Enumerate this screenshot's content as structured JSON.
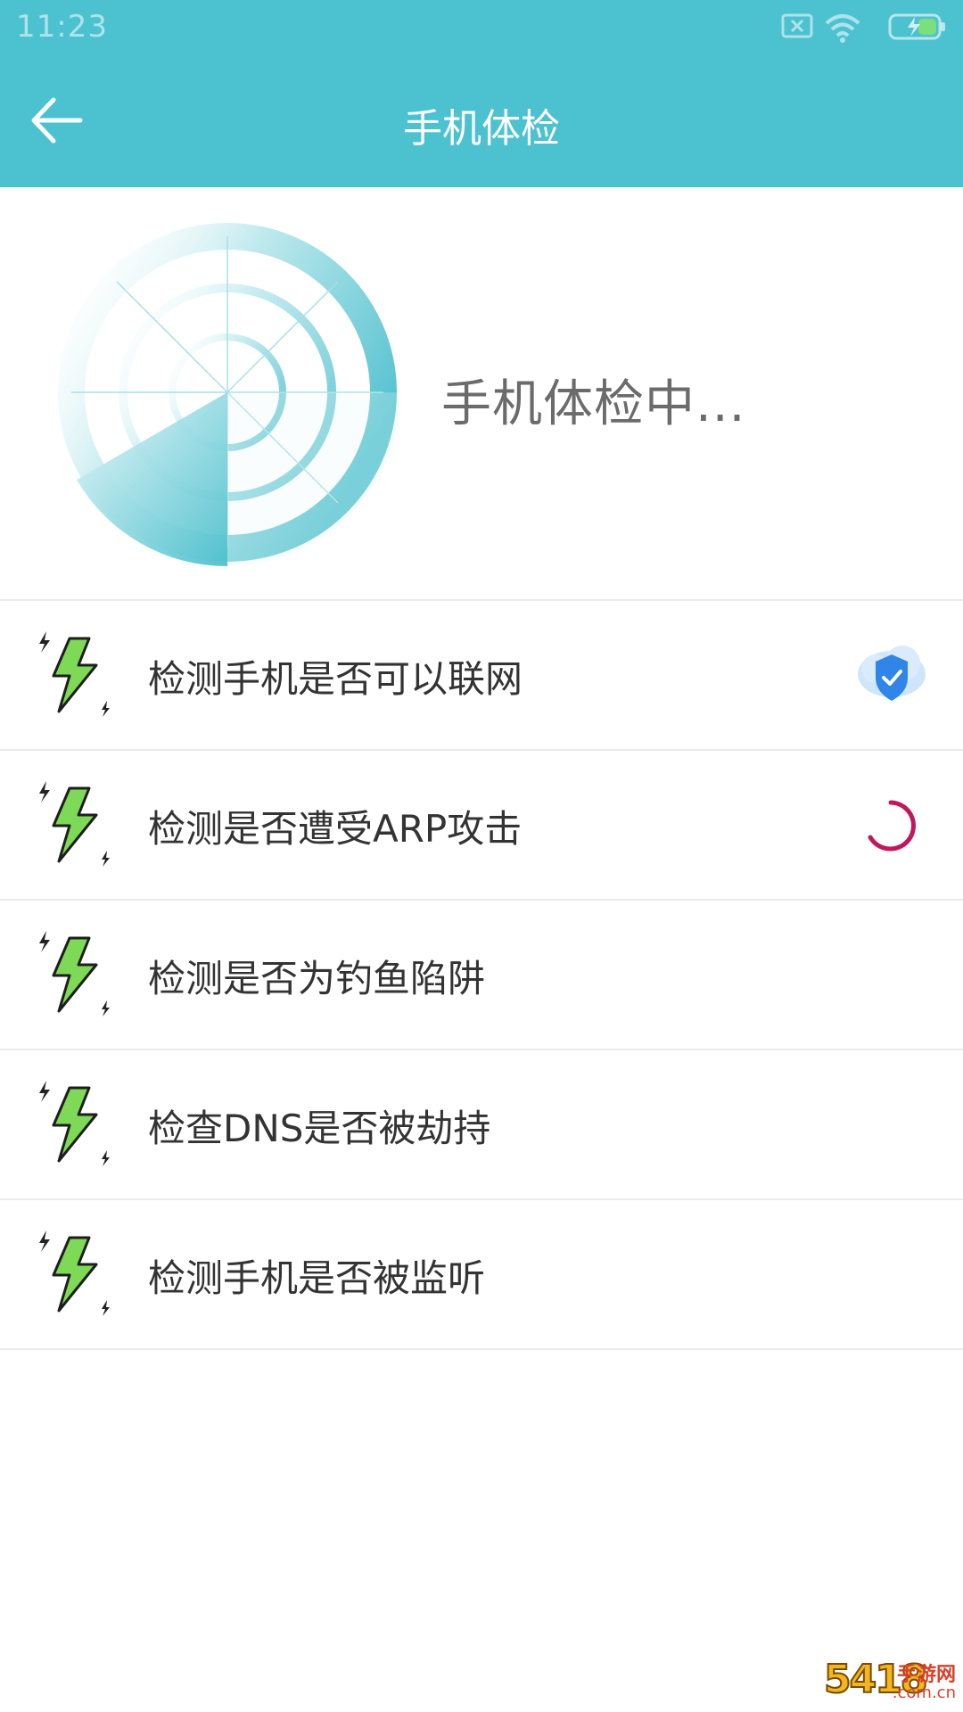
{
  "status_bar": {
    "time": "11:23",
    "icons": [
      "sim-off-icon",
      "wifi-icon",
      "battery-charging-icon"
    ]
  },
  "header": {
    "title": "手机体检",
    "back_icon": "arrow-left-icon"
  },
  "scan": {
    "status_text": "手机体检中..."
  },
  "checks": [
    {
      "label": "检测手机是否可以联网",
      "state": "done",
      "state_icon": "shield-check-icon"
    },
    {
      "label": "检测是否遭受ARP攻击",
      "state": "checking",
      "state_icon": "loading-spinner-icon"
    },
    {
      "label": "检测是否为钓鱼陷阱",
      "state": "pending"
    },
    {
      "label": "检查DNS是否被劫持",
      "state": "pending"
    },
    {
      "label": "检测手机是否被监听",
      "state": "pending"
    }
  ],
  "watermark": {
    "number": "5418",
    "name": "手游网",
    "domain": ".com.cn"
  },
  "colors": {
    "header": "#4cc2d1",
    "accent": "#45c1cf",
    "bolt": "#7ed957",
    "shield": "#2f86e8",
    "spinner": "#c2185b"
  }
}
